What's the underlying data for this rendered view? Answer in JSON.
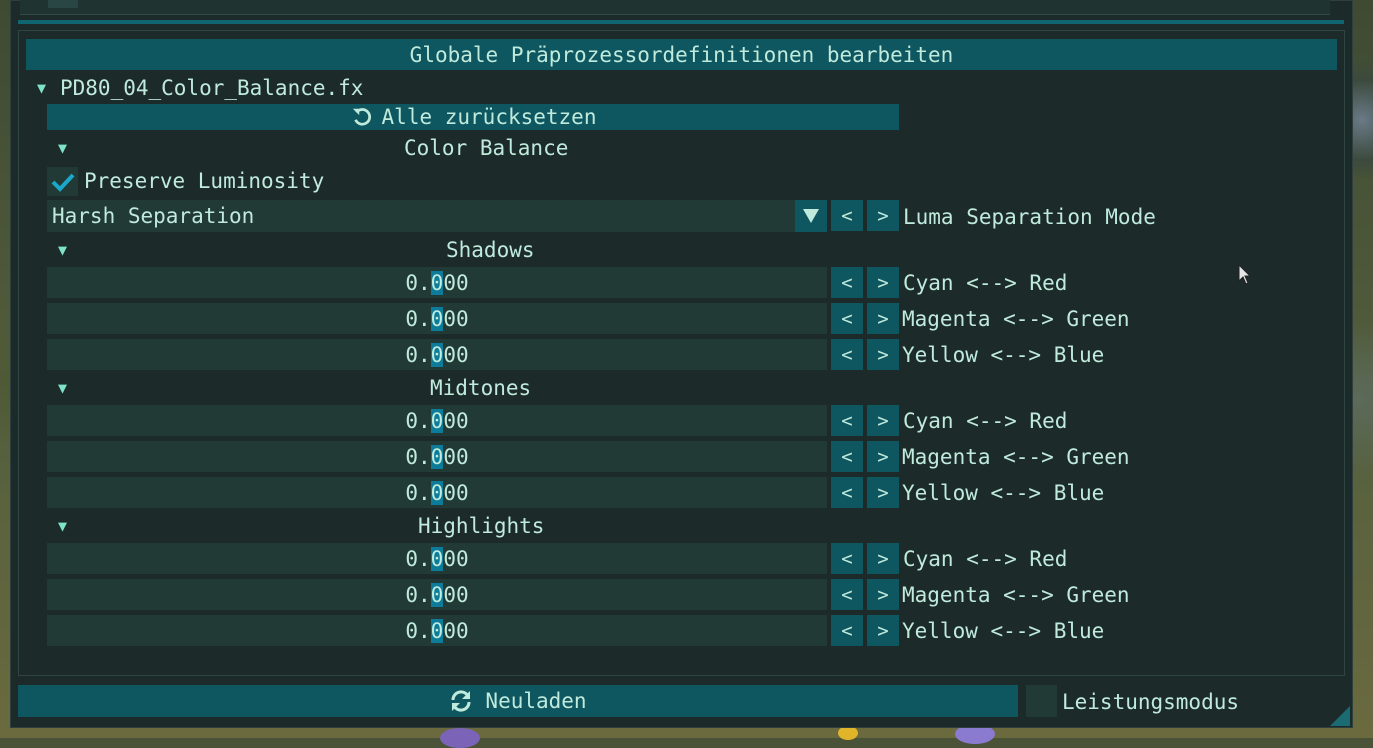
{
  "header": {
    "title": "Globale Präprozessordefinitionen bearbeiten"
  },
  "file": {
    "name": "PD80_04_Color_Balance.fx"
  },
  "reset_all": {
    "label": "Alle zurücksetzen",
    "icon": "undo-icon"
  },
  "color_balance": {
    "label": "Color Balance"
  },
  "preserve_luminosity": {
    "label": "Preserve Luminosity",
    "checked": true
  },
  "luma_mode": {
    "value": "Harsh Separation",
    "label": "Luma Separation Mode"
  },
  "stepper": {
    "prev": "<",
    "next": ">"
  },
  "sections": [
    {
      "title": "Shadows",
      "rows": [
        {
          "value_prefix": "0.",
          "value_cursor": "0",
          "value_suffix": "00",
          "label": "Cyan <--> Red"
        },
        {
          "value_prefix": "0.",
          "value_cursor": "0",
          "value_suffix": "00",
          "label": "Magenta <--> Green"
        },
        {
          "value_prefix": "0.",
          "value_cursor": "0",
          "value_suffix": "00",
          "label": "Yellow <--> Blue"
        }
      ]
    },
    {
      "title": "Midtones",
      "rows": [
        {
          "value_prefix": "0.",
          "value_cursor": "0",
          "value_suffix": "00",
          "label": "Cyan <--> Red"
        },
        {
          "value_prefix": "0.",
          "value_cursor": "0",
          "value_suffix": "00",
          "label": "Magenta <--> Green"
        },
        {
          "value_prefix": "0.",
          "value_cursor": "0",
          "value_suffix": "00",
          "label": "Yellow <--> Blue"
        }
      ]
    },
    {
      "title": "Highlights",
      "rows": [
        {
          "value_prefix": "0.",
          "value_cursor": "0",
          "value_suffix": "00",
          "label": "Cyan <--> Red"
        },
        {
          "value_prefix": "0.",
          "value_cursor": "0",
          "value_suffix": "00",
          "label": "Magenta <--> Green"
        },
        {
          "value_prefix": "0.",
          "value_cursor": "0",
          "value_suffix": "00",
          "label": "Yellow <--> Blue"
        }
      ]
    }
  ],
  "footer": {
    "reload_label": "Neuladen",
    "reload_icon": "refresh-icon",
    "performance_label": "Leistungsmodus",
    "performance_checked": false
  },
  "colors": {
    "window_bg": "#1c2b29",
    "accent": "#0e5660",
    "field_bg": "#213a35",
    "text": "#bfeadc",
    "cursor": "#0d7c9a",
    "check": "#1aa7c9"
  }
}
